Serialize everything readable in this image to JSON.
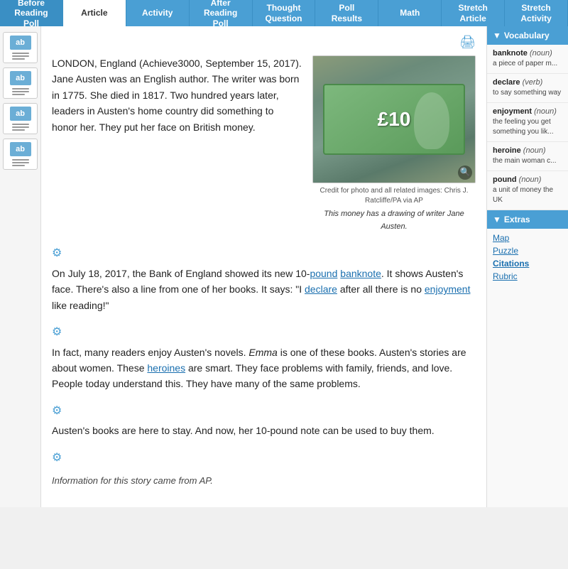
{
  "nav": {
    "tabs": [
      {
        "label": "Before Reading Poll",
        "active": false
      },
      {
        "label": "Article",
        "active": true
      },
      {
        "label": "Activity",
        "active": false
      },
      {
        "label": "After Reading Poll",
        "active": false
      },
      {
        "label": "Thought Question",
        "active": false
      },
      {
        "label": "Poll Results",
        "active": false
      },
      {
        "label": "Math",
        "active": false
      },
      {
        "label": "Stretch Article",
        "active": false
      },
      {
        "label": "Stretch Activity",
        "active": false
      }
    ]
  },
  "article": {
    "print_icon": "🖨",
    "intro": "LONDON, England (Achieve3000, September 15, 2017). Jane Austen was an English author. The writer was born in 1775. She died in 1817. Two hundred years later, leaders in Austen's home country did something to honor her. They put her face on British money.",
    "image_credit": "Credit for photo and all related images: Chris J. Ratcliffe/PA via AP",
    "image_caption": "This money has a drawing of writer Jane Austen.",
    "banknote_label": "£10",
    "paragraph2": "On July 18, 2017, the Bank of England showed its new 10-pound banknote. It shows Austen's face. There's also a line from one of her books. It says: \"I declare after all there is no enjoyment like reading!\"",
    "paragraph3_pre": "In fact, many readers enjoy Austen's novels.",
    "paragraph3_em": "Emma",
    "paragraph3_post": "is one of these books. Austen's stories are about women. These heroines are smart. They face problems with family, friends, and love. People today understand this. They have many of the same problems.",
    "paragraph4": "Austen's books are here to stay. And now, her 10-pound note can be used to buy them.",
    "footer": "Information for this story came from AP.",
    "audio_icon": "⚙"
  },
  "sidebar_tools": [
    {
      "label": "tool1"
    },
    {
      "label": "tool2"
    },
    {
      "label": "tool3"
    },
    {
      "label": "tool4"
    }
  ],
  "supporting": {
    "vocab_header": "▼  Vocabulary",
    "vocab_items": [
      {
        "word": "banknote",
        "pos": "(noun)",
        "def": "a piece of paper m..."
      },
      {
        "word": "declare",
        "pos": "(verb)",
        "def": "to say something way"
      },
      {
        "word": "enjoyment",
        "pos": "(noun)",
        "def": "the feeling you get something you lik..."
      },
      {
        "word": "heroine",
        "pos": "(noun)",
        "def": "the main woman c..."
      },
      {
        "word": "pound",
        "pos": "(noun)",
        "def": "a unit of money the UK"
      }
    ],
    "extras_header": "▼  Extras",
    "extras_links": [
      {
        "label": "Map"
      },
      {
        "label": "Puzzle"
      },
      {
        "label": "Citations"
      },
      {
        "label": "Rubric"
      }
    ]
  }
}
